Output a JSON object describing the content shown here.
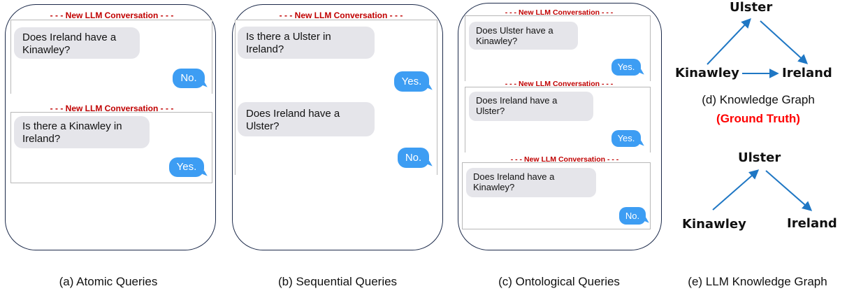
{
  "conversation_header": "- - - New LLM Conversation - - -",
  "panel_a": {
    "caption": "(a) Atomic Queries",
    "conv1": {
      "question": "Does Ireland have a Kinawley?",
      "answer": "No."
    },
    "conv2": {
      "question": "Is there a Kinawley in Ireland?",
      "answer": "Yes."
    }
  },
  "panel_b": {
    "caption": "(b) Sequential Queries",
    "q1": "Is there a Ulster in Ireland?",
    "a1": "Yes.",
    "q2": "Does Ireland have a Ulster?",
    "a2": "No."
  },
  "panel_c": {
    "caption": "(c) Ontological Queries",
    "conv1": {
      "question": "Does Ulster have a Kinawley?",
      "answer": "Yes."
    },
    "conv2": {
      "question": "Does Ireland have a Ulster?",
      "answer": "Yes."
    },
    "conv3": {
      "question": "Does Ireland have a Kinawley?",
      "answer": "No."
    }
  },
  "panel_d": {
    "caption": "(d) Knowledge Graph",
    "caption_note": "(Ground Truth)",
    "caption_note_color": "#ff0000",
    "nodes": {
      "top": "Ulster",
      "left": "Kinawley",
      "right": "Ireland"
    }
  },
  "panel_e": {
    "caption": "(e) LLM Knowledge Graph",
    "nodes": {
      "top": "Ulster",
      "left": "Kinawley",
      "right": "Ireland"
    }
  },
  "colors": {
    "bubble_out": "#3d9df3",
    "bubble_in": "#e5e5ea",
    "header": "#c00000",
    "arrow": "#1f77c4",
    "frame": "#1c2a4a"
  }
}
